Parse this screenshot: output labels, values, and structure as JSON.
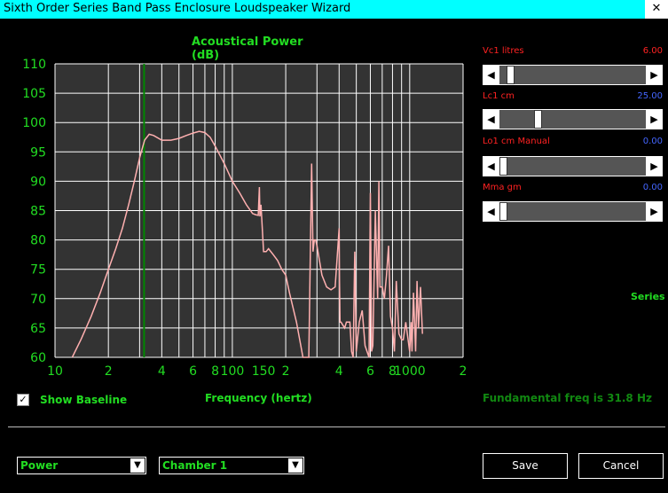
{
  "window": {
    "title": "Sixth Order Series Band Pass Enclosure Loudspeaker Wizard",
    "close_glyph": "✕"
  },
  "chart": {
    "title": "Acoustical Power (dB)",
    "xlabel": "Frequency (hertz)"
  },
  "chart_data": {
    "type": "line",
    "title": "Acoustical Power (dB)",
    "xlabel": "Frequency (hertz)",
    "ylabel": "",
    "xscale": "log",
    "xlim": [
      10,
      2000
    ],
    "ylim": [
      60,
      110
    ],
    "grid": true,
    "y_ticks": [
      "110",
      "105",
      "100",
      "95",
      "90",
      "85",
      "80",
      "75",
      "70",
      "65",
      "60"
    ],
    "x_ticks": [
      {
        "v": 10,
        "label": "10"
      },
      {
        "v": 20,
        "label": "2"
      },
      {
        "v": 40,
        "label": "4"
      },
      {
        "v": 60,
        "label": "6"
      },
      {
        "v": 80,
        "label": "8"
      },
      {
        "v": 100,
        "label": "100"
      },
      {
        "v": 150,
        "label": "150"
      },
      {
        "v": 200,
        "label": "2"
      },
      {
        "v": 400,
        "label": "4"
      },
      {
        "v": 600,
        "label": "6"
      },
      {
        "v": 800,
        "label": "8"
      },
      {
        "v": 1000,
        "label": "1000"
      },
      {
        "v": 2000,
        "label": "2"
      }
    ],
    "marker_freq": 31.8,
    "series": [
      {
        "color": "#ffb0b0",
        "x": [
          12.5,
          14,
          16,
          18,
          20,
          22,
          24,
          26,
          28,
          30,
          32,
          34,
          36,
          40,
          45,
          50,
          55,
          60,
          65,
          70,
          75,
          80,
          90,
          100,
          110,
          120,
          130,
          135,
          140,
          142,
          143,
          145,
          150,
          155,
          160,
          170,
          180,
          190,
          200,
          210,
          230,
          250,
          270,
          280,
          285,
          290,
          292,
          295,
          300,
          320,
          340,
          360,
          380,
          400,
          402,
          405,
          410,
          430,
          440,
          460,
          470,
          480,
          490,
          500,
          520,
          540,
          560,
          590,
          600,
          610,
          620,
          640,
          660,
          670,
          680,
          700,
          720,
          740,
          760,
          780,
          800,
          820,
          840,
          870,
          900,
          920,
          950,
          1000,
          1020,
          1030,
          1050,
          1080,
          1100,
          1120,
          1150,
          1180
        ],
        "y": [
          60,
          63,
          67,
          71,
          75,
          78.5,
          82,
          86,
          90,
          94,
          97,
          98,
          97.8,
          97,
          97,
          97.3,
          97.8,
          98.2,
          98.5,
          98.3,
          97.5,
          96,
          93,
          90,
          88,
          86,
          84.5,
          84.3,
          84.2,
          89,
          84,
          86,
          78,
          78,
          78.5,
          77.5,
          76.5,
          75,
          74,
          71,
          66,
          60,
          60,
          93,
          78,
          80,
          80,
          80,
          79,
          74,
          72,
          71.5,
          72,
          82,
          73,
          66,
          66,
          65,
          66,
          66,
          61,
          60,
          78,
          61,
          66,
          68,
          62,
          60,
          88,
          61,
          62,
          85,
          70,
          90,
          72,
          72,
          70,
          74,
          79,
          67,
          65,
          61,
          73,
          64,
          63,
          63,
          66,
          61,
          66,
          61,
          71,
          61,
          73,
          65,
          72,
          64
        ]
      }
    ]
  },
  "sliders": [
    {
      "label": "Vc1  litres",
      "value": "6.00",
      "value_color": "#ff2222",
      "thumb_frac": 0.05
    },
    {
      "label": "Lc1  cm",
      "value": "25.00",
      "value_color": "#4466ff",
      "thumb_frac": 0.25
    },
    {
      "label": "Lo1  cm  Manual",
      "value": "0.00",
      "value_color": "#4466ff",
      "thumb_frac": 0.0
    },
    {
      "label": "Mma  gm",
      "value": "0.00",
      "value_color": "#4466ff",
      "thumb_frac": 0.0
    }
  ],
  "series_label": "Series",
  "baseline": {
    "checked": true,
    "label": "Show Baseline"
  },
  "fundamental": "Fundamental freq is 31.8 Hz",
  "selects": {
    "plot_type": "Power",
    "chamber": "Chamber 1"
  },
  "buttons": {
    "save": "Save",
    "cancel": "Cancel"
  },
  "glyphs": {
    "left": "◀",
    "right": "▶",
    "down": "▼",
    "check": "✓"
  },
  "colors": {
    "title_bar": "#00ffff",
    "label_green": "#22dd22",
    "grid": "#ffffff",
    "plot_bg": "#333333",
    "marker": "#008800"
  }
}
